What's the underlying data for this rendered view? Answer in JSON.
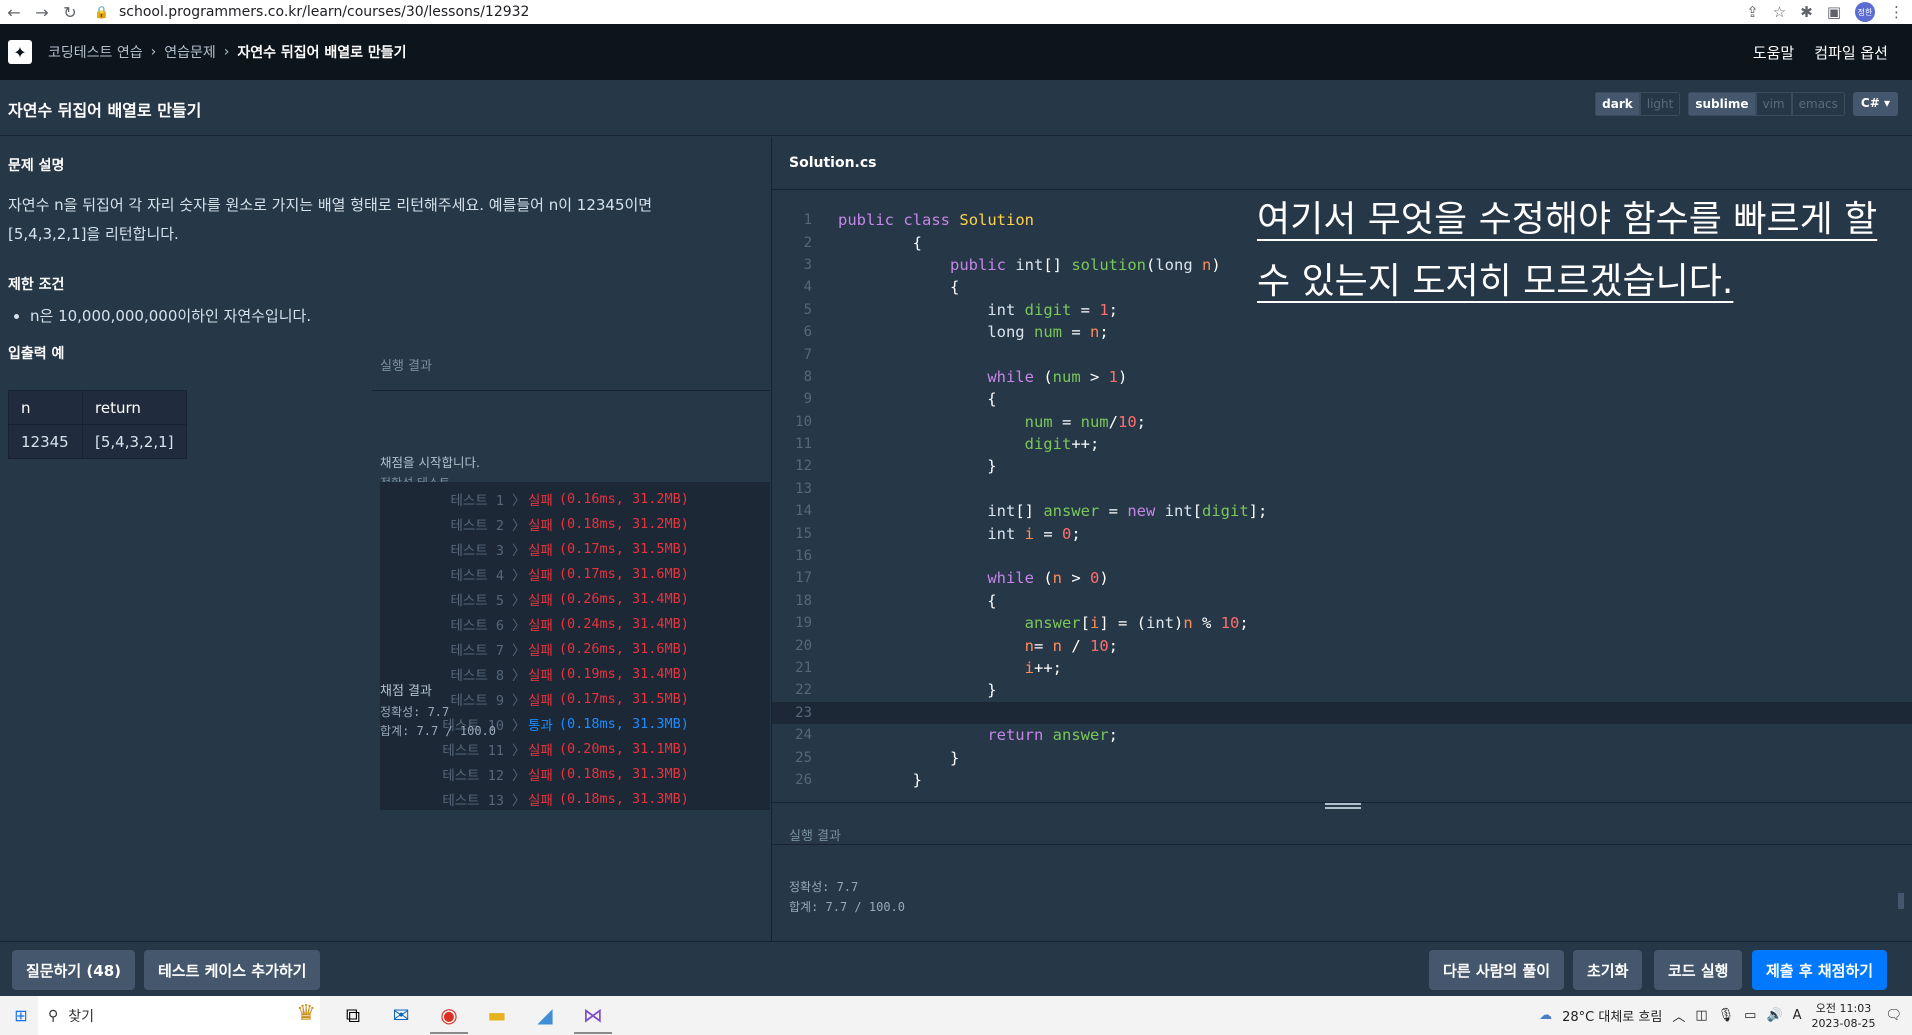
{
  "browser": {
    "url": "school.programmers.co.kr/learn/courses/30/lessons/12932",
    "profile_initials": "정한"
  },
  "nav": {
    "crumbs": [
      "코딩테스트 연습",
      "연습문제"
    ],
    "current": "자연수 뒤집어 배열로 만들기",
    "menu": [
      "도움말",
      "컴파일 옵션"
    ]
  },
  "titlebar": {
    "title": "자연수 뒤집어 배열로 만들기",
    "theme_options": [
      "dark",
      "light"
    ],
    "theme_selected": "dark",
    "keymap_options": [
      "sublime",
      "vim",
      "emacs"
    ],
    "keymap_selected": "sublime",
    "language": "C#"
  },
  "problem": {
    "desc_heading": "문제 설명",
    "desc_text": "자연수 n을 뒤집어 각 자리 숫자를 원소로 가지는 배열 형태로 리턴해주세요. 예를들어 n이 12345이면 [5,4,3,2,1]을 리턴합니다.",
    "limit_heading": "제한 조건",
    "limits": [
      "n은 10,000,000,000이하인 자연수입니다."
    ],
    "io_heading": "입출력 예",
    "io_headers": [
      "n",
      "return"
    ],
    "io_rows": [
      [
        "12345",
        "[5,4,3,2,1]"
      ]
    ]
  },
  "results": {
    "label": "실행 결과",
    "start_msg": "채점을 시작합니다.",
    "tabs_text": "정확성  테스트",
    "tests": [
      {
        "name": "테스트 1",
        "status": "실패",
        "detail": "(0.16ms, 31.2MB)",
        "pass": false
      },
      {
        "name": "테스트 2",
        "status": "실패",
        "detail": "(0.18ms, 31.2MB)",
        "pass": false
      },
      {
        "name": "테스트 3",
        "status": "실패",
        "detail": "(0.17ms, 31.5MB)",
        "pass": false
      },
      {
        "name": "테스트 4",
        "status": "실패",
        "detail": "(0.17ms, 31.6MB)",
        "pass": false
      },
      {
        "name": "테스트 5",
        "status": "실패",
        "detail": "(0.26ms, 31.4MB)",
        "pass": false
      },
      {
        "name": "테스트 6",
        "status": "실패",
        "detail": "(0.24ms, 31.4MB)",
        "pass": false
      },
      {
        "name": "테스트 7",
        "status": "실패",
        "detail": "(0.26ms, 31.6MB)",
        "pass": false
      },
      {
        "name": "테스트 8",
        "status": "실패",
        "detail": "(0.19ms, 31.4MB)",
        "pass": false
      },
      {
        "name": "테스트 9",
        "status": "실패",
        "detail": "(0.17ms, 31.5MB)",
        "pass": false
      },
      {
        "name": "테스트 10",
        "status": "통과",
        "detail": "(0.18ms, 31.3MB)",
        "pass": true
      },
      {
        "name": "테스트 11",
        "status": "실패",
        "detail": "(0.20ms, 31.1MB)",
        "pass": false
      },
      {
        "name": "테스트 12",
        "status": "실패",
        "detail": "(0.18ms, 31.3MB)",
        "pass": false
      },
      {
        "name": "테스트 13",
        "status": "실패",
        "detail": "(0.18ms, 31.3MB)",
        "pass": false
      }
    ],
    "summary_heading": "채점 결과",
    "accuracy": "정확성: 7.7",
    "total": "합계: 7.7 / 100.0"
  },
  "editor": {
    "filename": "Solution.cs",
    "overlay_note": "여기서 무엇을 수정해야 함수를 빠르게 할 수 있는지 도저히 모르겠습니다.",
    "output_label": "실행 결과",
    "output_accuracy": "정확성: 7.7",
    "output_total": "합계: 7.7 / 100.0"
  },
  "actions": {
    "question": "질문하기 (48)",
    "add_testcase": "테스트 케이스 추가하기",
    "others_solutions": "다른 사람의 풀이",
    "reset": "초기화",
    "run": "코드 실행",
    "submit": "제출 후 채점하기"
  },
  "taskbar": {
    "search_label": "찾기",
    "weather": "28°C 대체로 흐림",
    "ime": "A",
    "time": "오전 11:03",
    "date": "2023-08-25"
  }
}
